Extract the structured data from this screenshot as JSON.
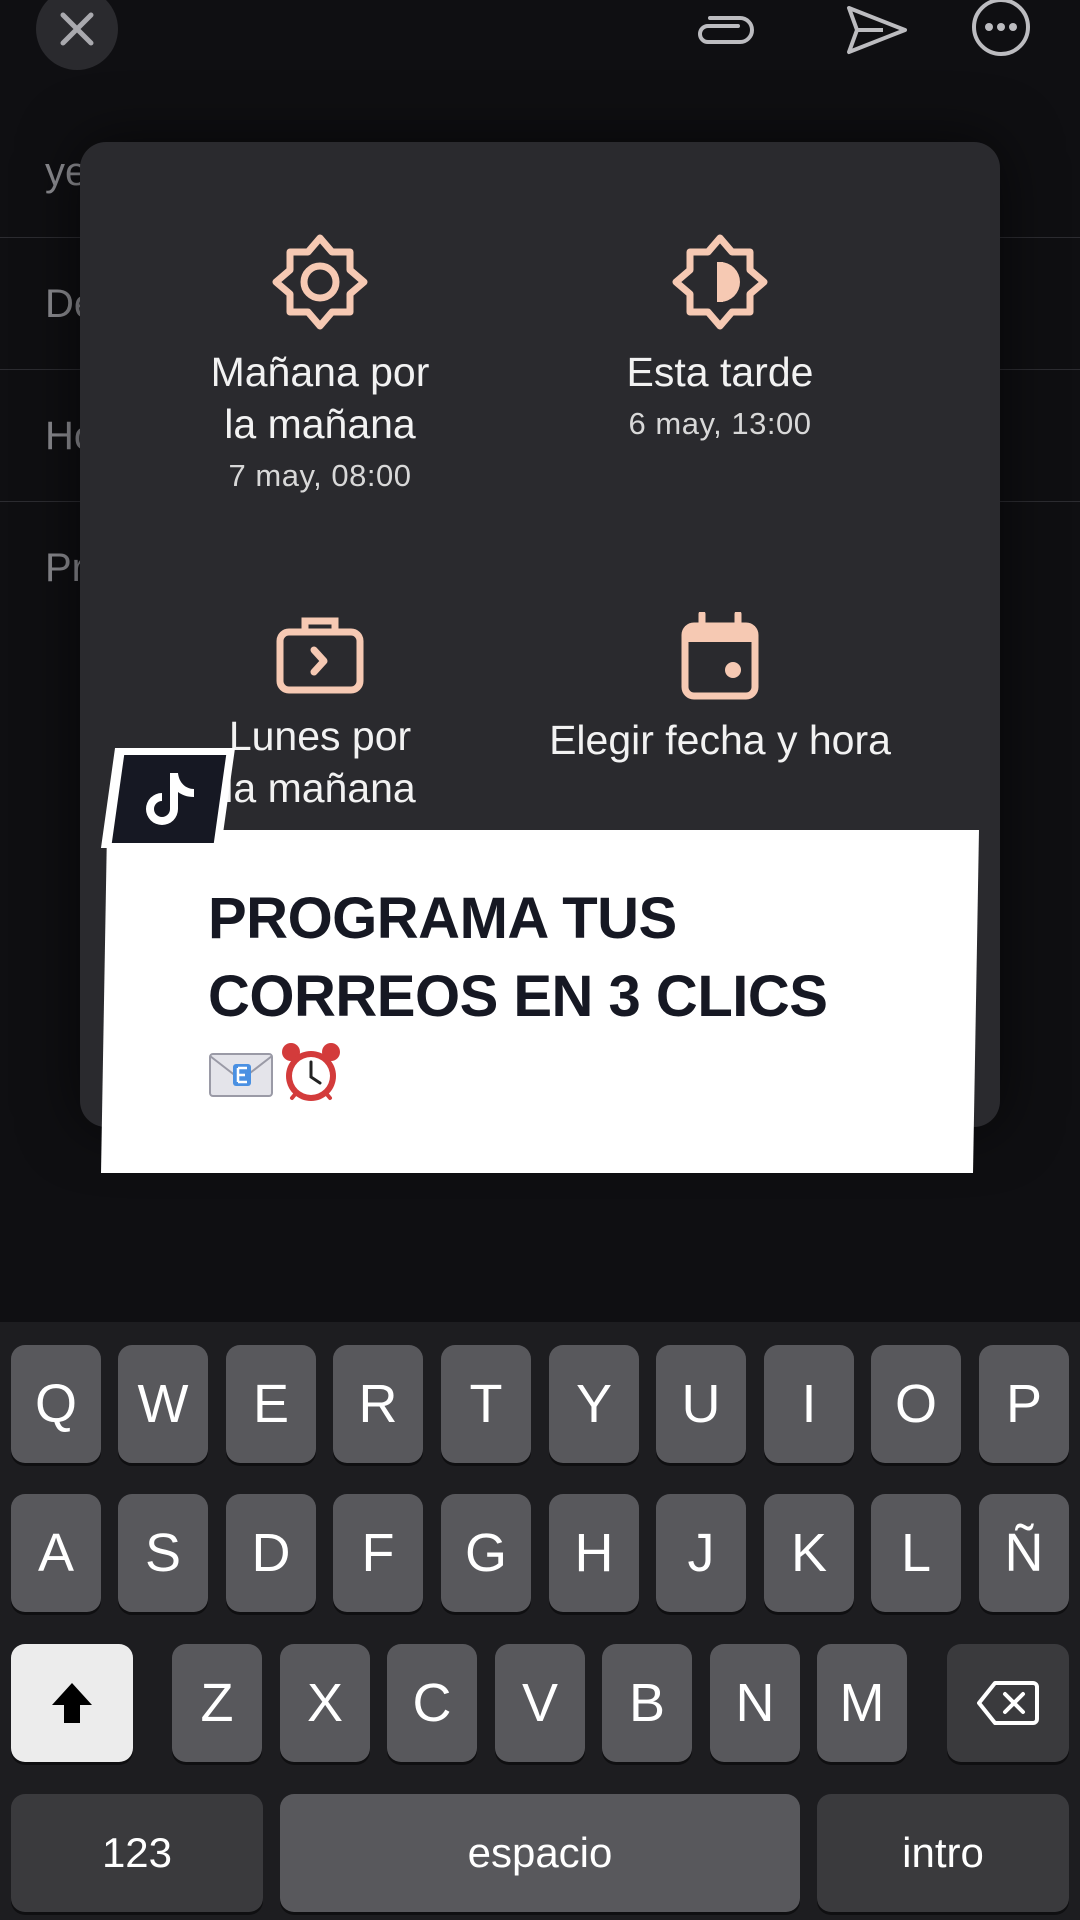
{
  "compose": {
    "rows": [
      "ye",
      "De",
      "Ho",
      "Pr"
    ]
  },
  "schedule_popup": {
    "options": [
      {
        "label": "Mañana por\nla mañana",
        "sub": "7 may, 08:00",
        "icon": "sun-icon"
      },
      {
        "label": "Esta tarde",
        "sub": "6 may, 13:00",
        "icon": "half-sun-icon"
      },
      {
        "label": "Lunes por\nla mañana",
        "sub": "",
        "icon": "briefcase-icon"
      },
      {
        "label": "Elegir fecha y hora",
        "sub": "",
        "icon": "calendar-icon"
      }
    ],
    "accent_color": "#f6c9b3"
  },
  "overlay": {
    "title": "PROGRAMA TUS\nCORREOS EN 3 CLICS",
    "emoji": [
      "envelope-icon",
      "alarm-clock-icon"
    ]
  },
  "keyboard": {
    "row1": [
      "Q",
      "W",
      "E",
      "R",
      "T",
      "Y",
      "U",
      "I",
      "O",
      "P"
    ],
    "row2": [
      "A",
      "S",
      "D",
      "F",
      "G",
      "H",
      "J",
      "K",
      "L",
      "Ñ"
    ],
    "row3": [
      "Z",
      "X",
      "C",
      "V",
      "B",
      "N",
      "M"
    ],
    "numbers_key": "123",
    "space_key": "espacio",
    "return_key": "intro"
  }
}
